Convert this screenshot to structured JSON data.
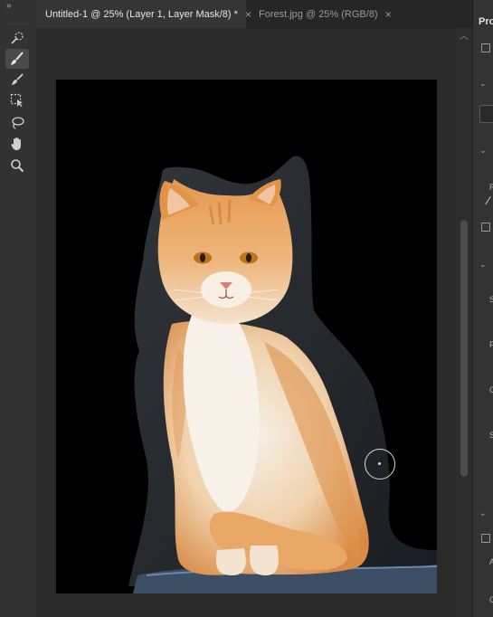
{
  "toolbar": {
    "collapse_glyph": "»",
    "tools": [
      {
        "name": "quick-selection-icon",
        "active": false
      },
      {
        "name": "brush-icon",
        "active": true
      },
      {
        "name": "eraser-brush-icon",
        "active": false
      },
      {
        "name": "object-selection-icon",
        "active": false
      },
      {
        "name": "lasso-icon",
        "active": false
      },
      {
        "name": "hand-icon",
        "active": false
      },
      {
        "name": "zoom-icon",
        "active": false
      }
    ]
  },
  "tabs": [
    {
      "label": "Untitled-1 @ 25% (Layer 1, Layer Mask/8) *",
      "close": "×",
      "active": true
    },
    {
      "label": "Forest.jpg @ 25% (RGB/8)",
      "close": "×",
      "active": false
    }
  ],
  "panel": {
    "title": "Prop",
    "letters": [
      "R",
      "S",
      "F",
      "C",
      "S",
      "A",
      "C"
    ]
  },
  "colors": {
    "app_bg": "#282828",
    "toolbar_bg": "#323232",
    "canvas_bg": "#000000",
    "cat_orange": "#e6a05c",
    "cat_white": "#f4ece2"
  }
}
